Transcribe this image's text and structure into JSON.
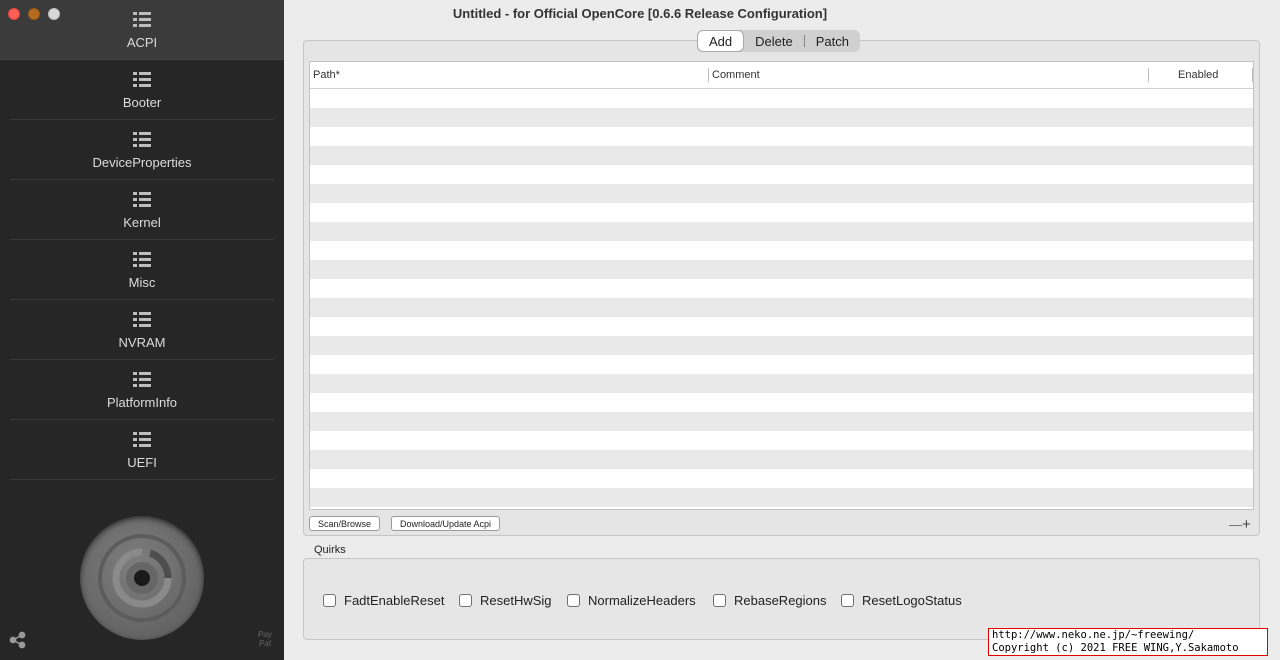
{
  "window": {
    "title": "Untitled - for Official OpenCore [0.6.6 Release Configuration]"
  },
  "sidebar": {
    "items": [
      {
        "label": "ACPI",
        "icon": "list-icon",
        "active": true
      },
      {
        "label": "Booter",
        "icon": "list-icon"
      },
      {
        "label": "DeviceProperties",
        "icon": "list-icon"
      },
      {
        "label": "Kernel",
        "icon": "list-icon"
      },
      {
        "label": "Misc",
        "icon": "list-icon"
      },
      {
        "label": "NVRAM",
        "icon": "list-icon"
      },
      {
        "label": "PlatformInfo",
        "icon": "list-icon"
      },
      {
        "label": "UEFI",
        "icon": "list-icon"
      }
    ],
    "paypal": "Pay Pal"
  },
  "tabs": [
    {
      "label": "Add",
      "active": true
    },
    {
      "label": "Delete"
    },
    {
      "label": "Patch"
    }
  ],
  "table": {
    "columns": [
      "Path*",
      "Comment",
      "Enabled"
    ],
    "rows": []
  },
  "buttons": {
    "scan": "Scan/Browse",
    "download": "Download/Update Acpi",
    "remove": "—",
    "add": "+"
  },
  "quirks": {
    "label": "Quirks",
    "items": [
      {
        "label": "FadtEnableReset",
        "checked": false
      },
      {
        "label": "ResetHwSig",
        "checked": false
      },
      {
        "label": "NormalizeHeaders",
        "checked": false
      },
      {
        "label": "RebaseRegions",
        "checked": false
      },
      {
        "label": "ResetLogoStatus",
        "checked": false
      }
    ]
  },
  "watermark": {
    "line1": "http://www.neko.ne.jp/~freewing/",
    "line2": "Copyright (c) 2021 FREE WING,Y.Sakamoto"
  },
  "colors": {
    "sidebar_bg": "#262626",
    "sidebar_active": "#3b3b3b",
    "close": "#fe5f57",
    "minimize": "#b56a1e",
    "maximize": "#d8d8d8",
    "watermark_border": "#e00000"
  }
}
